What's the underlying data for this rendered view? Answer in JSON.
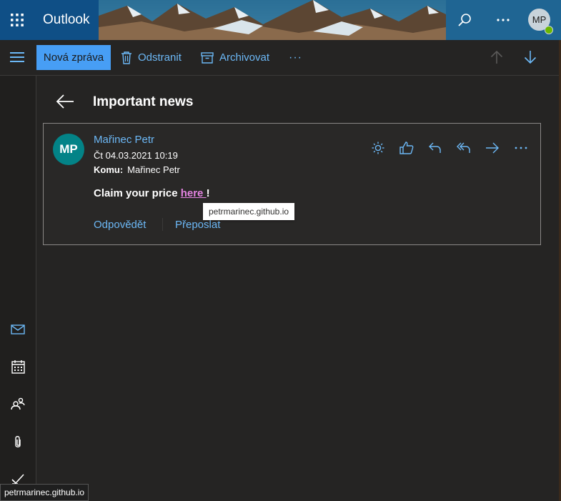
{
  "app": {
    "name": "Outlook",
    "user_initials": "MP"
  },
  "header": {
    "waffle_icon": "app-launcher-icon",
    "search_icon": "search-icon",
    "more_icon": "more-icon",
    "presence_color": "#6bb700"
  },
  "toolbar": {
    "menu_icon": "hamburger-icon",
    "new_message": "Nová zpráva",
    "delete": "Odstranit",
    "archive": "Archivovat",
    "more": "···",
    "up_icon": "arrow-up-icon",
    "down_icon": "arrow-down-icon"
  },
  "leftrail": {
    "items": [
      "mail-icon",
      "calendar-icon",
      "people-icon",
      "attachment-icon",
      "todo-icon"
    ]
  },
  "message": {
    "subject": "Important news",
    "sender_initials": "MP",
    "sender_name": "Mařinec Petr",
    "date": "Čt 04.03.2021 10:19",
    "to_label": "Komu:",
    "to_value": "Mařinec Petr",
    "body_prefix": "Claim your price ",
    "link_text": "here ",
    "body_suffix": "!",
    "reply": "Odpovědět",
    "forward": "Přeposlat"
  },
  "tooltip": {
    "text": "petrmarinec.github.io"
  },
  "statusbar": {
    "url": "petrmarinec.github.io"
  },
  "colors": {
    "accent": "#479ef5",
    "link_visited": "#e484e2",
    "avatar_teal": "#038387",
    "brand_blue": "#0f4f86"
  }
}
